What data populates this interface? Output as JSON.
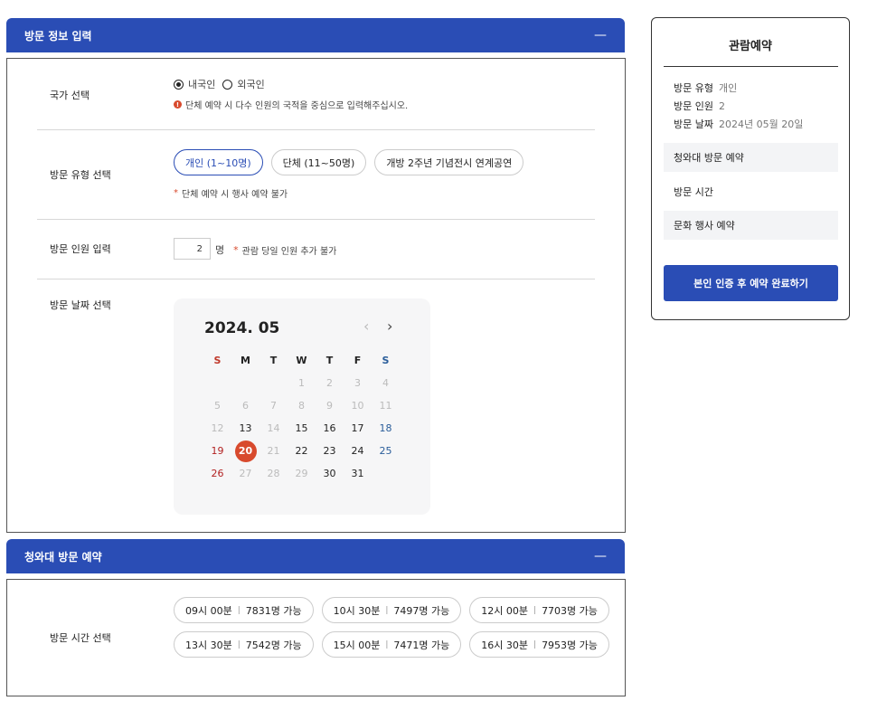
{
  "visit_info": {
    "title": "방문 정보 입력",
    "collapse_label": "—",
    "country": {
      "label": "국가 선택",
      "options": [
        {
          "label": "내국인",
          "selected": true
        },
        {
          "label": "외국인",
          "selected": false
        }
      ],
      "note_icon": "!",
      "note": "단체 예약 시 다수 인원의 국적을 중심으로 입력해주십시오."
    },
    "type": {
      "label": "방문 유형 선택",
      "options": [
        {
          "label": "개인 (1~10명)",
          "selected": true
        },
        {
          "label": "단체 (11~50명)",
          "selected": false
        },
        {
          "label": "개방 2주년 기념전시 연계공연",
          "selected": false
        }
      ],
      "note_star": "*",
      "note": "단체 예약 시 행사 예약 불가"
    },
    "count": {
      "label": "방문 인원 입력",
      "value": "2",
      "unit": "명",
      "note_star": "*",
      "note": "관람 당일 인원 추가 불가"
    },
    "date": {
      "label": "방문 날짜 선택",
      "calendar": {
        "title": "2024. 05",
        "prev": "‹",
        "next": "›",
        "weekdays": [
          "S",
          "M",
          "T",
          "W",
          "T",
          "F",
          "S"
        ],
        "weeks": [
          [
            {
              "d": ""
            },
            {
              "d": ""
            },
            {
              "d": ""
            },
            {
              "d": "1",
              "s": "disabled"
            },
            {
              "d": "2",
              "s": "disabled"
            },
            {
              "d": "3",
              "s": "disabled"
            },
            {
              "d": "4",
              "s": "disabled"
            }
          ],
          [
            {
              "d": "5",
              "s": "disabled"
            },
            {
              "d": "6",
              "s": "disabled"
            },
            {
              "d": "7",
              "s": "disabled"
            },
            {
              "d": "8",
              "s": "disabled"
            },
            {
              "d": "9",
              "s": "disabled"
            },
            {
              "d": "10",
              "s": "disabled"
            },
            {
              "d": "11",
              "s": "disabled"
            }
          ],
          [
            {
              "d": "12",
              "s": "disabled"
            },
            {
              "d": "13",
              "s": "active"
            },
            {
              "d": "14",
              "s": "disabled"
            },
            {
              "d": "15",
              "s": "active"
            },
            {
              "d": "16",
              "s": "active"
            },
            {
              "d": "17",
              "s": "active"
            },
            {
              "d": "18",
              "s": "sat"
            }
          ],
          [
            {
              "d": "19",
              "s": "sun"
            },
            {
              "d": "20",
              "s": "selected"
            },
            {
              "d": "21",
              "s": "disabled"
            },
            {
              "d": "22",
              "s": "active"
            },
            {
              "d": "23",
              "s": "active"
            },
            {
              "d": "24",
              "s": "active"
            },
            {
              "d": "25",
              "s": "sat"
            }
          ],
          [
            {
              "d": "26",
              "s": "sun"
            },
            {
              "d": "27",
              "s": "disabled"
            },
            {
              "d": "28",
              "s": "disabled"
            },
            {
              "d": "29",
              "s": "disabled"
            },
            {
              "d": "30",
              "s": "active"
            },
            {
              "d": "31",
              "s": "active"
            },
            {
              "d": ""
            }
          ]
        ]
      }
    }
  },
  "cheongwadae": {
    "title": "청와대 방문 예약",
    "collapse_label": "—",
    "time": {
      "label": "방문 시간 선택",
      "slots": [
        {
          "time": "09시 00분",
          "avail": "7831명 가능"
        },
        {
          "time": "10시 30분",
          "avail": "7497명 가능"
        },
        {
          "time": "12시 00분",
          "avail": "7703명 가능"
        },
        {
          "time": "13시 30분",
          "avail": "7542명 가능"
        },
        {
          "time": "15시 00분",
          "avail": "7471명 가능"
        },
        {
          "time": "16시 30분",
          "avail": "7953명 가능"
        }
      ],
      "separator": "|"
    }
  },
  "summary": {
    "title": "관람예약",
    "info": [
      {
        "key": "방문 유형",
        "value": "개인"
      },
      {
        "key": "방문 인원",
        "value": "2"
      },
      {
        "key": "방문 날짜",
        "value": "2024년 05월 20일"
      }
    ],
    "items": [
      "청와대 방문 예약",
      "방문 시간",
      "문화 행사 예약"
    ],
    "button": "본인 인증 후 예약 완료하기"
  },
  "colors": {
    "accent": "#2a4db5",
    "selected_day": "#d84a2d",
    "sunday": "#b22222",
    "saturday": "#2a5d9a"
  }
}
